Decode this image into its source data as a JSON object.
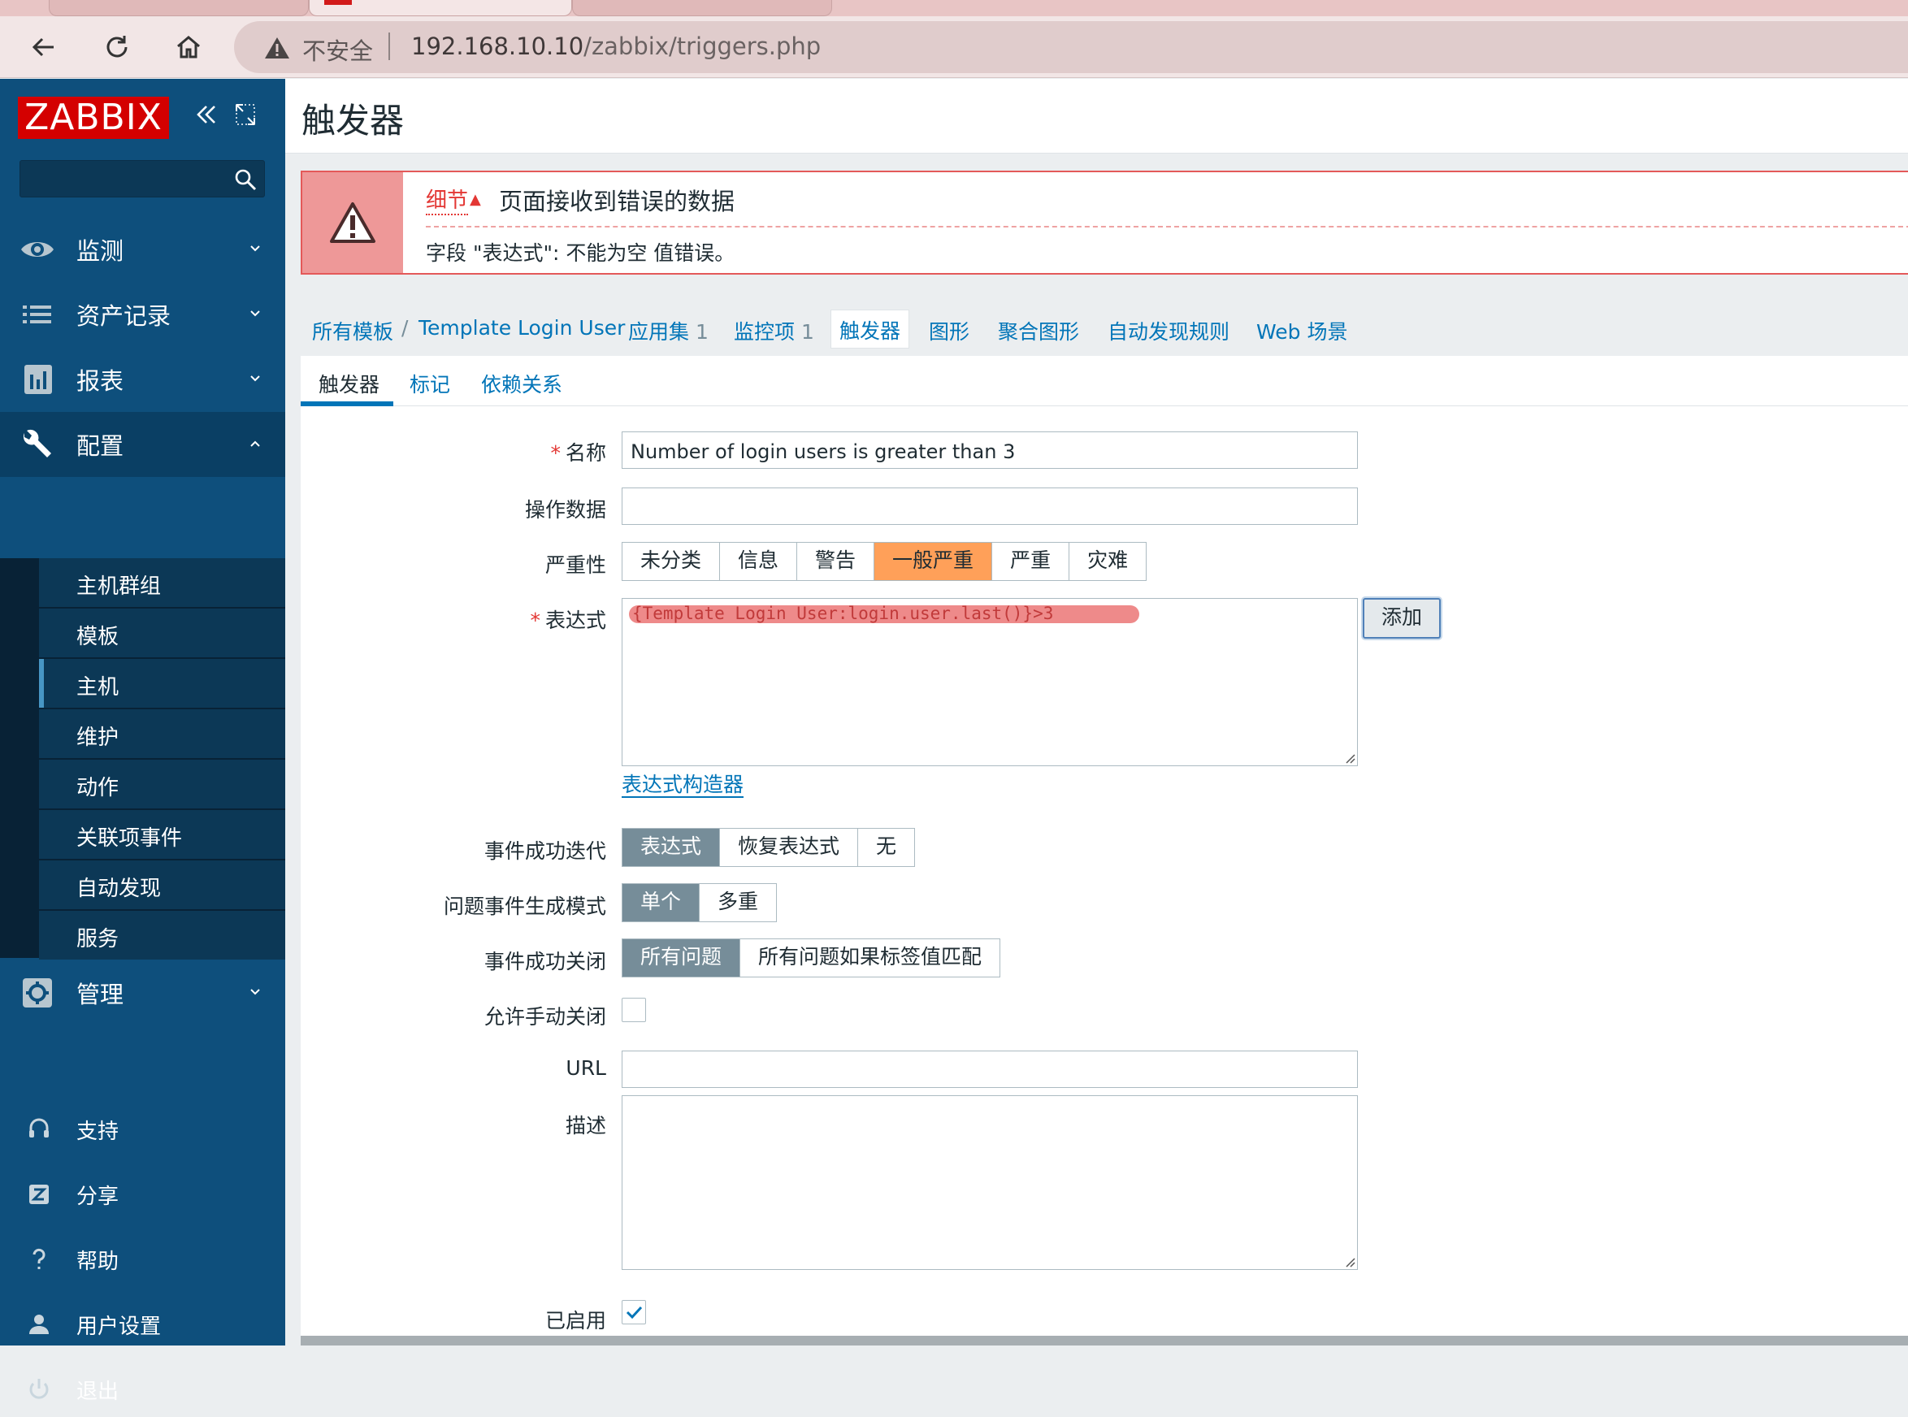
{
  "browser": {
    "not_secure": "不安全",
    "url_host": "192.168.10.10",
    "url_path": "/zabbix/triggers.php"
  },
  "sidebar": {
    "logo": "ZABBIX",
    "search_placeholder": "",
    "menu": [
      {
        "label": "监测",
        "icon": "eye-icon"
      },
      {
        "label": "资产记录",
        "icon": "list-icon"
      },
      {
        "label": "报表",
        "icon": "bar-chart-icon"
      },
      {
        "label": "配置",
        "icon": "wrench-icon"
      },
      {
        "label": "管理",
        "icon": "gear-icon"
      }
    ],
    "submenu": [
      "主机群组",
      "模板",
      "主机",
      "维护",
      "动作",
      "关联项事件",
      "自动发现",
      "服务"
    ],
    "bottom": [
      {
        "label": "支持",
        "icon": "headset-icon"
      },
      {
        "label": "分享",
        "icon": "share-z-icon"
      },
      {
        "label": "帮助",
        "icon": "question-icon"
      },
      {
        "label": "用户设置",
        "icon": "user-icon"
      },
      {
        "label": "退出",
        "icon": "power-icon"
      }
    ]
  },
  "page": {
    "title": "触发器"
  },
  "message": {
    "details": "细节",
    "title": "页面接收到错误的数据",
    "text": "字段 \"表达式\": 不能为空 值错误。"
  },
  "nav": {
    "all_templates": "所有模板",
    "separator": "/",
    "template": "Template Login User",
    "applications": "应用集",
    "applications_count": "1",
    "items": "监控项",
    "items_count": "1",
    "triggers": "触发器",
    "graphs": "图形",
    "screens": "聚合图形",
    "discovery": "自动发现规则",
    "web": "Web 场景"
  },
  "form_tabs": [
    "触发器",
    "标记",
    "依赖关系"
  ],
  "form": {
    "required_mark": "*",
    "name_label": "名称",
    "name_value": "Number of login users is greater than 3",
    "opdata_label": "操作数据",
    "opdata_value": "",
    "severity_label": "严重性",
    "severity_options": [
      "未分类",
      "信息",
      "警告",
      "一般严重",
      "严重",
      "灾难"
    ],
    "severity_selected": "一般严重",
    "expression_label": "表达式",
    "expression_value": "{Template Login User:login.user.last()}>3",
    "add_button": "添加",
    "expression_builder": "表达式构造器",
    "ok_event_label": "事件成功迭代",
    "ok_event_options": [
      "表达式",
      "恢复表达式",
      "无"
    ],
    "problem_mode_label": "问题事件生成模式",
    "problem_mode_options": [
      "单个",
      "多重"
    ],
    "ok_close_label": "事件成功关闭",
    "ok_close_options": [
      "所有问题",
      "所有问题如果标签值匹配"
    ],
    "manual_close_label": "允许手动关闭",
    "manual_close_checked": false,
    "url_label": "URL",
    "url_value": "",
    "description_label": "描述",
    "description_value": "",
    "enabled_label": "已启用",
    "enabled_checked": true
  },
  "colors": {
    "sidebar": "#0e4f7c",
    "accent_link": "#0275b8",
    "error_red": "#e45959",
    "severity_average": "#ffa059",
    "toggle_selected": "#768d99"
  }
}
